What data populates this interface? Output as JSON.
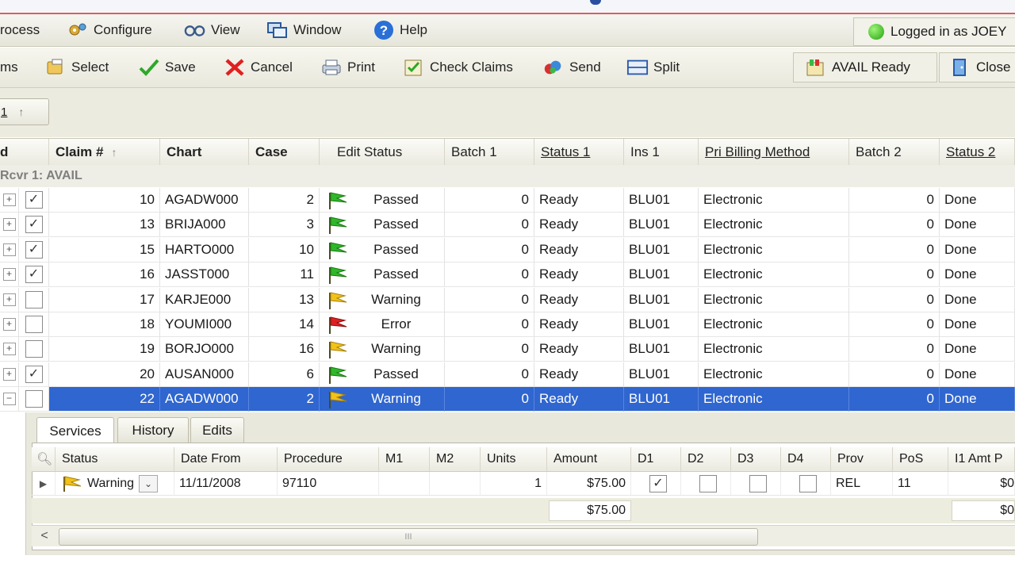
{
  "menu": {
    "items": [
      {
        "label": "rocess",
        "icon": "process-icon"
      },
      {
        "label": "Configure",
        "icon": "configure-icon"
      },
      {
        "label": "View",
        "icon": "view-icon"
      },
      {
        "label": "Window",
        "icon": "window-icon"
      },
      {
        "label": "Help",
        "icon": "help-icon"
      }
    ],
    "logged_in": "Logged in as JOEY"
  },
  "toolbar": {
    "claims": "ms",
    "select": "Select",
    "save": "Save",
    "cancel": "Cancel",
    "print": "Print",
    "check_claims": "Check Claims",
    "send": "Send",
    "split": "Split",
    "avail_ready": "AVAIL Ready",
    "close": "Close"
  },
  "group_chip": "1",
  "grid": {
    "headers": [
      "d",
      "Claim #",
      "Chart",
      "Case",
      "Edit Status",
      "Batch 1",
      "Status 1",
      "Ins 1",
      "Pri Billing Method",
      "Batch 2",
      "Status 2"
    ],
    "group_label": "Rcvr 1: AVAIL",
    "rows": [
      {
        "checked": true,
        "claim": "10",
        "chart": "AGADW000",
        "case": "2",
        "flag": "green",
        "edit_status": "Passed",
        "batch1": "0",
        "status1": "Ready",
        "ins1": "BLU01",
        "billing": "Electronic",
        "batch2": "0",
        "status2": "Done"
      },
      {
        "checked": true,
        "claim": "13",
        "chart": "BRIJA000",
        "case": "3",
        "flag": "green",
        "edit_status": "Passed",
        "batch1": "0",
        "status1": "Ready",
        "ins1": "BLU01",
        "billing": "Electronic",
        "batch2": "0",
        "status2": "Done"
      },
      {
        "checked": true,
        "claim": "15",
        "chart": "HARTO000",
        "case": "10",
        "flag": "green",
        "edit_status": "Passed",
        "batch1": "0",
        "status1": "Ready",
        "ins1": "BLU01",
        "billing": "Electronic",
        "batch2": "0",
        "status2": "Done"
      },
      {
        "checked": true,
        "claim": "16",
        "chart": "JASST000",
        "case": "11",
        "flag": "green",
        "edit_status": "Passed",
        "batch1": "0",
        "status1": "Ready",
        "ins1": "BLU01",
        "billing": "Electronic",
        "batch2": "0",
        "status2": "Done"
      },
      {
        "checked": false,
        "claim": "17",
        "chart": "KARJE000",
        "case": "13",
        "flag": "yellow",
        "edit_status": "Warning",
        "batch1": "0",
        "status1": "Ready",
        "ins1": "BLU01",
        "billing": "Electronic",
        "batch2": "0",
        "status2": "Done"
      },
      {
        "checked": false,
        "claim": "18",
        "chart": "YOUMI000",
        "case": "14",
        "flag": "red",
        "edit_status": "Error",
        "batch1": "0",
        "status1": "Ready",
        "ins1": "BLU01",
        "billing": "Electronic",
        "batch2": "0",
        "status2": "Done"
      },
      {
        "checked": false,
        "claim": "19",
        "chart": "BORJO000",
        "case": "16",
        "flag": "yellow",
        "edit_status": "Warning",
        "batch1": "0",
        "status1": "Ready",
        "ins1": "BLU01",
        "billing": "Electronic",
        "batch2": "0",
        "status2": "Done"
      },
      {
        "checked": true,
        "claim": "20",
        "chart": "AUSAN000",
        "case": "6",
        "flag": "green",
        "edit_status": "Passed",
        "batch1": "0",
        "status1": "Ready",
        "ins1": "BLU01",
        "billing": "Electronic",
        "batch2": "0",
        "status2": "Done"
      },
      {
        "checked": false,
        "claim": "22",
        "chart": "AGADW000",
        "case": "2",
        "flag": "yellow",
        "edit_status": "Warning",
        "batch1": "0",
        "status1": "Ready",
        "ins1": "BLU01",
        "billing": "Electronic",
        "batch2": "0",
        "status2": "Done",
        "selected": true
      }
    ]
  },
  "detail": {
    "tabs": [
      "Services",
      "History",
      "Edits"
    ],
    "headers": [
      "Status",
      "Date From",
      "Procedure",
      "M1",
      "M2",
      "Units",
      "Amount",
      "D1",
      "D2",
      "D3",
      "D4",
      "Prov",
      "PoS",
      "I1 Amt P"
    ],
    "row": {
      "status": "Warning",
      "date_from": "11/11/2008",
      "procedure": "97110",
      "m1": "",
      "m2": "",
      "units": "1",
      "amount": "$75.00",
      "d1": true,
      "d2": false,
      "d3": false,
      "d4": false,
      "prov": "REL",
      "pos": "11",
      "i1_amt": "$0"
    },
    "total_amount": "$75.00",
    "total_i1": "$0",
    "scroll_grip": "III"
  },
  "colors": {
    "selection": "#2f66d0",
    "flag_green": "#2fb82a",
    "flag_yellow": "#f2c21a",
    "flag_red": "#e02020"
  }
}
